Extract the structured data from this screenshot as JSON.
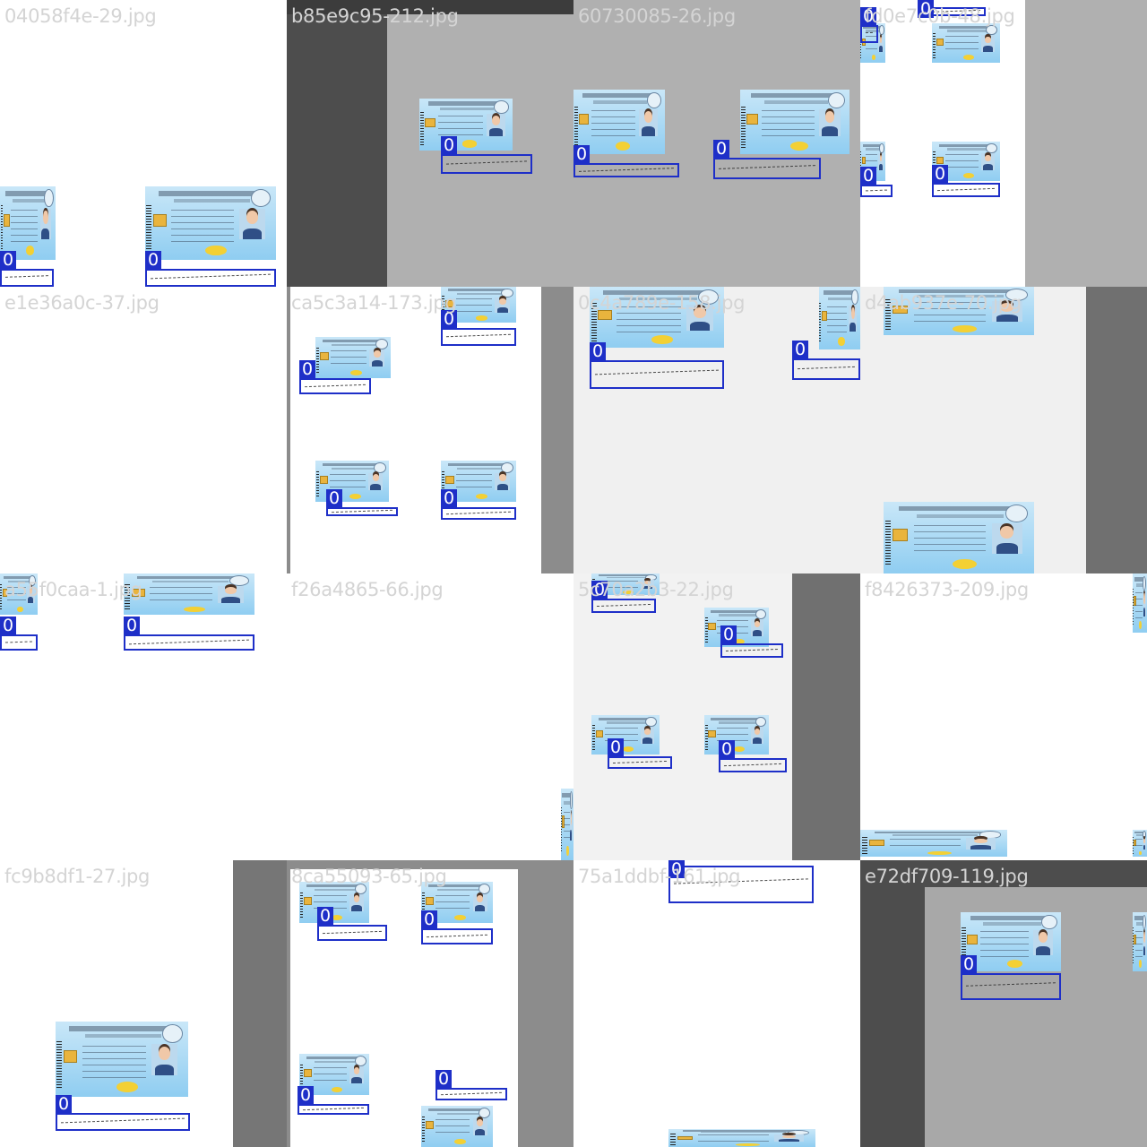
{
  "colors": {
    "bbox": "#1e2fc8",
    "label_fg": "#ffffff",
    "filename_text": "#d4d4d4",
    "card_top": "#c9e7f8",
    "card_bottom": "#8fcdf1"
  },
  "icons": [
    "thai-id-card-icon",
    "portrait-photo-icon",
    "chip-icon",
    "barcode-icon",
    "garuda-seal-icon"
  ],
  "tiles": [
    {
      "filename": "04058f4e-29.jpg",
      "bg": "#ffffff",
      "fills": [],
      "cards": [
        [
          0,
          208,
          62,
          82
        ],
        [
          162,
          208,
          146,
          82
        ]
      ],
      "boxes": [
        {
          "r": [
            0,
            300,
            60,
            20
          ],
          "label": "0"
        },
        {
          "r": [
            162,
            300,
            146,
            20
          ],
          "label": "0"
        }
      ]
    },
    {
      "filename": "b85e9c95-212.jpg",
      "bg": "#4d4d4d",
      "fills": [
        [
          "#3c3c3c",
          0,
          0,
          320,
          16
        ],
        [
          "#b0b0b0",
          112,
          16,
          208,
          304
        ]
      ],
      "cards": [
        [
          148,
          110,
          104,
          58
        ]
      ],
      "boxes": [
        {
          "r": [
            172,
            172,
            102,
            22
          ],
          "label": "0"
        }
      ]
    },
    {
      "filename": "60730085-26.jpg",
      "bg": "#b0b0b0",
      "fills": [],
      "cards": [
        [
          0,
          100,
          102,
          72
        ],
        [
          186,
          100,
          122,
          72
        ]
      ],
      "boxes": [
        {
          "r": [
            0,
            182,
            118,
            16
          ],
          "label": "0"
        },
        {
          "r": [
            156,
            176,
            120,
            24
          ],
          "label": "0"
        }
      ]
    },
    {
      "filename": "fd0e7c0b-48.jpg",
      "bg": "#ffffff",
      "fills": [
        [
          "#b0b0b0",
          184,
          0,
          136,
          320
        ]
      ],
      "cards": [
        [
          0,
          26,
          28,
          44
        ],
        [
          80,
          26,
          76,
          44
        ],
        [
          0,
          158,
          28,
          44
        ],
        [
          80,
          158,
          76,
          44
        ]
      ],
      "boxes": [
        {
          "r": [
            0,
            28,
            20,
            20
          ],
          "label": "0"
        },
        {
          "r": [
            64,
            8,
            76,
            10
          ],
          "label": "0"
        },
        {
          "r": [
            0,
            206,
            36,
            14
          ],
          "label": "0"
        },
        {
          "r": [
            80,
            204,
            76,
            16
          ],
          "label": "0"
        }
      ]
    },
    {
      "filename": "e1e36a0c-37.jpg",
      "bg": "#ffffff",
      "fills": [],
      "cards": [
        [
          0,
          320,
          104,
          52
        ]
      ],
      "boxes": []
    },
    {
      "filename": "ca5c3a14-173.jpg",
      "bg": "#ffffff",
      "fills": [
        [
          "#8c8c8c",
          0,
          0,
          4,
          320
        ],
        [
          "#8c8c8c",
          284,
          0,
          36,
          320
        ]
      ],
      "cards": [
        [
          172,
          0,
          84,
          40
        ],
        [
          32,
          56,
          84,
          46
        ],
        [
          32,
          194,
          82,
          46
        ],
        [
          172,
          194,
          84,
          46
        ]
      ],
      "boxes": [
        {
          "r": [
            172,
            46,
            84,
            20
          ],
          "label": "0"
        },
        {
          "r": [
            14,
            102,
            80,
            18
          ],
          "label": "0"
        },
        {
          "r": [
            44,
            246,
            80,
            10
          ],
          "label": "0"
        },
        {
          "r": [
            172,
            246,
            84,
            14
          ],
          "label": "0"
        }
      ]
    },
    {
      "filename": "0c4a789e-158.jpg",
      "bg": "#f0f0f0",
      "fills": [],
      "cards": [
        [
          18,
          0,
          150,
          68
        ],
        [
          274,
          0,
          46,
          70
        ]
      ],
      "boxes": [
        {
          "r": [
            18,
            82,
            150,
            32
          ],
          "label": "0"
        },
        {
          "r": [
            244,
            80,
            76,
            24
          ],
          "label": "0"
        }
      ]
    },
    {
      "filename": "d4ab937e-70.jpg",
      "bg": "#f0f0f0",
      "fills": [
        [
          "#707070",
          252,
          0,
          68,
          320
        ]
      ],
      "cards": [
        [
          26,
          0,
          168,
          54
        ],
        [
          26,
          240,
          168,
          80
        ]
      ],
      "boxes": []
    },
    {
      "filename": "a55f0caa-1.jpg",
      "bg": "#ffffff",
      "fills": [],
      "cards": [
        [
          0,
          0,
          42,
          46
        ],
        [
          138,
          0,
          146,
          46
        ]
      ],
      "boxes": [
        {
          "r": [
            0,
            68,
            42,
            18
          ],
          "label": "0"
        },
        {
          "r": [
            138,
            68,
            146,
            18
          ],
          "label": "0"
        }
      ]
    },
    {
      "filename": "f26a4865-66.jpg",
      "bg": "#ffffff",
      "fills": [],
      "cards": [
        [
          306,
          240,
          14,
          80
        ]
      ],
      "boxes": []
    },
    {
      "filename": "5c70a2b3-22.jpg",
      "bg": "#f2f2f2",
      "fills": [
        [
          "#707070",
          244,
          0,
          76,
          320
        ]
      ],
      "cards": [
        [
          20,
          0,
          76,
          24
        ],
        [
          146,
          38,
          72,
          44
        ],
        [
          20,
          158,
          76,
          44
        ],
        [
          146,
          158,
          72,
          44
        ]
      ],
      "boxes": [
        {
          "r": [
            20,
            28,
            72,
            16
          ],
          "label": "0"
        },
        {
          "r": [
            164,
            78,
            70,
            16
          ],
          "label": "0"
        },
        {
          "r": [
            38,
            204,
            72,
            14
          ],
          "label": "0"
        },
        {
          "r": [
            162,
            206,
            76,
            16
          ],
          "label": "0"
        }
      ]
    },
    {
      "filename": "f8426373-209.jpg",
      "bg": "#ffffff",
      "fills": [],
      "cards": [
        [
          304,
          0,
          16,
          66
        ],
        [
          0,
          286,
          164,
          30
        ],
        [
          304,
          286,
          16,
          30
        ]
      ],
      "boxes": []
    },
    {
      "filename": "fc9b8df1-27.jpg",
      "bg": "#ffffff",
      "fills": [
        [
          "#767676",
          260,
          0,
          60,
          320
        ]
      ],
      "cards": [
        [
          62,
          180,
          148,
          84
        ]
      ],
      "boxes": [
        {
          "r": [
            62,
            282,
            150,
            20
          ],
          "label": "0"
        }
      ]
    },
    {
      "filename": "8ca55093-65.jpg",
      "bg": "#8c8c8c",
      "fills": [
        [
          "#ffffff",
          4,
          10,
          254,
          310
        ]
      ],
      "cards": [
        [
          14,
          24,
          78,
          46
        ],
        [
          150,
          24,
          80,
          46
        ],
        [
          14,
          216,
          78,
          46
        ],
        [
          150,
          274,
          80,
          46
        ]
      ],
      "boxes": [
        {
          "r": [
            34,
            72,
            78,
            18
          ],
          "label": "0"
        },
        {
          "r": [
            150,
            76,
            80,
            18
          ],
          "label": "0"
        },
        {
          "r": [
            12,
            272,
            80,
            12
          ],
          "label": "0"
        },
        {
          "r": [
            166,
            254,
            80,
            14
          ],
          "label": "0"
        }
      ]
    },
    {
      "filename": "75a1ddbf-161.jpg",
      "bg": "#ffffff",
      "fills": [],
      "cards": [
        [
          106,
          300,
          164,
          20
        ]
      ],
      "boxes": [
        {
          "r": [
            106,
            6,
            162,
            42
          ],
          "label": "0"
        }
      ]
    },
    {
      "filename": "e72df709-119.jpg",
      "bg": "#4d4d4d",
      "fills": [
        [
          "#a8a8a8",
          72,
          30,
          248,
          290
        ]
      ],
      "cards": [
        [
          112,
          58,
          112,
          66
        ],
        [
          304,
          58,
          16,
          66
        ]
      ],
      "boxes": [
        {
          "r": [
            112,
            126,
            112,
            30
          ],
          "label": "0"
        }
      ]
    }
  ]
}
